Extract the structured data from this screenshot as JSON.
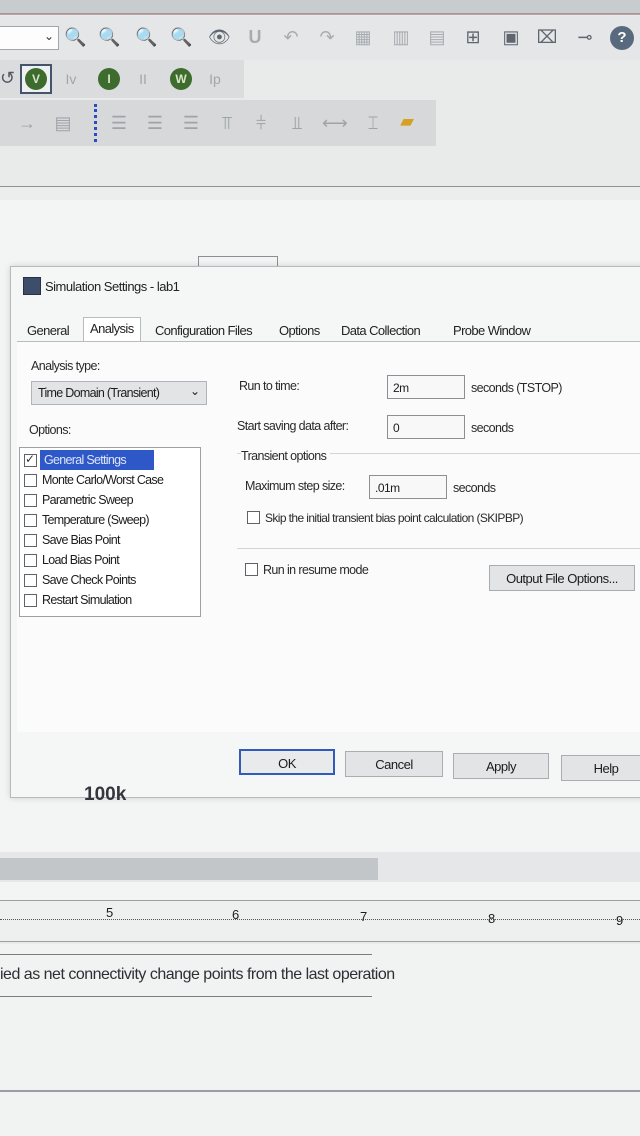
{
  "toolbar": {
    "row1_icons": [
      "dropdown-arrow-icon",
      "zoom-in-icon",
      "zoom-out-icon",
      "zoom-area-icon",
      "zoom-all-icon",
      "eye-icon",
      "text-icon",
      "undo-icon",
      "redo-icon",
      "grid-icon",
      "list-icon",
      "part-icon",
      "window-icon",
      "pin-icon",
      "probe-icon",
      "help-icon"
    ],
    "row1_help_glyph": "?",
    "row2_buttons": [
      {
        "glyph": "V",
        "name": "voltage-marker-icon"
      },
      {
        "glyph": "I",
        "name": "current-marker-icon"
      },
      {
        "glyph": "W",
        "name": "power-marker-icon"
      }
    ],
    "row2_text_icons": [
      "Iv",
      "II",
      "Ip"
    ]
  },
  "dialog": {
    "title": "Simulation Settings - lab1",
    "tabs": [
      "General",
      "Analysis",
      "Configuration Files",
      "Options",
      "Data Collection",
      "Probe Window"
    ],
    "active_tab": "Analysis",
    "analysis_type_label": "Analysis type:",
    "analysis_type_value": "Time Domain (Transient)",
    "options_label": "Options:",
    "options_items": [
      {
        "label": "General Settings",
        "checked": true,
        "selected": true
      },
      {
        "label": "Monte Carlo/Worst Case",
        "checked": false
      },
      {
        "label": "Parametric Sweep",
        "checked": false
      },
      {
        "label": "Temperature (Sweep)",
        "checked": false
      },
      {
        "label": "Save Bias Point",
        "checked": false
      },
      {
        "label": "Load Bias Point",
        "checked": false
      },
      {
        "label": "Save Check Points",
        "checked": false
      },
      {
        "label": "Restart Simulation",
        "checked": false
      }
    ],
    "run_to_time_label": "Run to time:",
    "run_to_time_value": "2m",
    "run_to_time_unit": "seconds (TSTOP)",
    "start_saving_label": "Start saving data after:",
    "start_saving_value": "0",
    "start_saving_unit": "seconds",
    "transient_options_label": "Transient options",
    "max_step_label": "Maximum step size:",
    "max_step_value": ".01m",
    "max_step_unit": "seconds",
    "skip_bias_label": "Skip the initial transient bias point calculation (SKIPBP)",
    "resume_mode_label": "Run in resume mode",
    "output_file_options_label": "Output File Options...",
    "ok_label": "OK",
    "cancel_label": "Cancel",
    "apply_label": "Apply",
    "help_label": "Help"
  },
  "canvas": {
    "component_value": "100k"
  },
  "ruler": {
    "marks": [
      "5",
      "6",
      "7",
      "8",
      "9"
    ]
  },
  "status": {
    "message": "ied as net connectivity change points from the last operation"
  }
}
